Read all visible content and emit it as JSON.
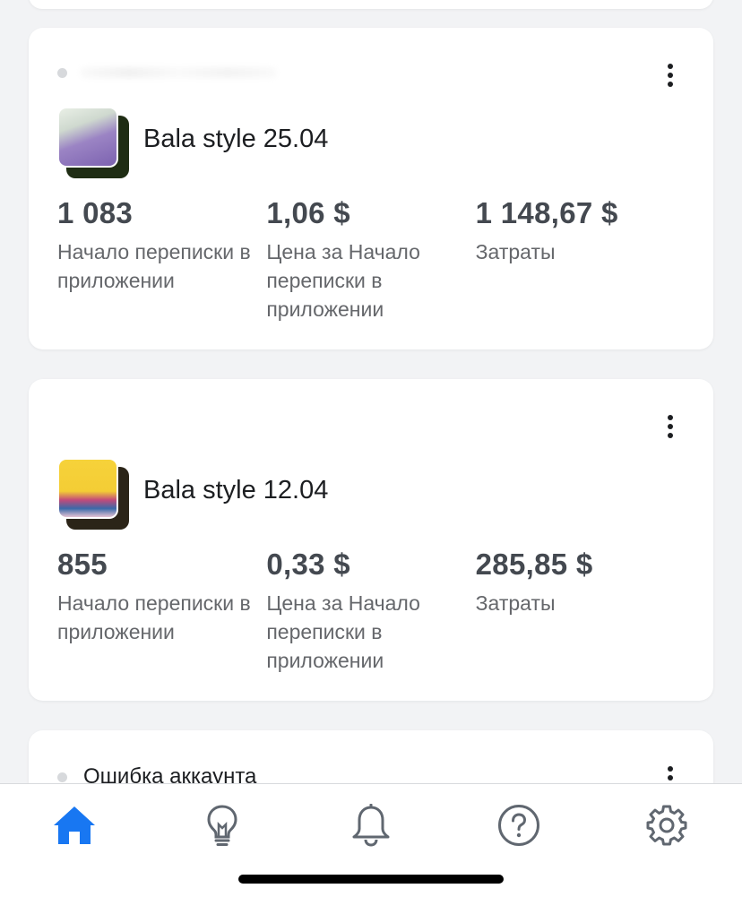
{
  "campaigns": [
    {
      "name": "Bala style 25.04",
      "metrics": [
        {
          "value": "1 083",
          "label": "Начало переписки в приложении"
        },
        {
          "value": "1,06 $",
          "label": "Цена за Начало переписки в приложении"
        },
        {
          "value": "1 148,67 $",
          "label": "Затраты"
        }
      ]
    },
    {
      "name": "Bala style 12.04",
      "metrics": [
        {
          "value": "855",
          "label": "Начало переписки в приложении"
        },
        {
          "value": "0,33 $",
          "label": "Цена за Начало переписки в приложении"
        },
        {
          "value": "285,85 $",
          "label": "Затраты"
        }
      ]
    }
  ],
  "account_error": {
    "status": "Ошибка аккаунта"
  },
  "tabbar": {
    "items": [
      {
        "icon": "home-icon",
        "active": true
      },
      {
        "icon": "lightbulb-icon",
        "active": false
      },
      {
        "icon": "bell-icon",
        "active": false
      },
      {
        "icon": "help-icon",
        "active": false
      },
      {
        "icon": "gear-icon",
        "active": false
      }
    ]
  },
  "colors": {
    "accent": "#1877f2",
    "icon": "#606770",
    "metric_value": "#444950",
    "metric_label": "#65676b"
  }
}
